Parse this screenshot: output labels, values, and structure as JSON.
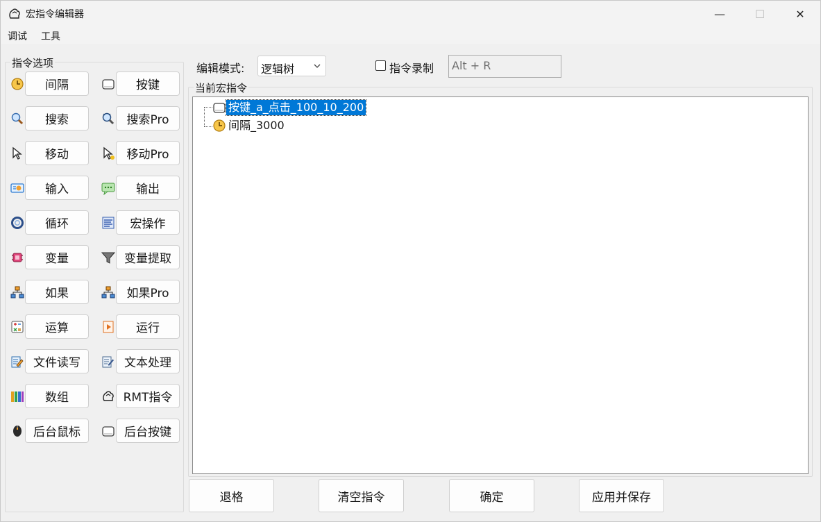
{
  "window": {
    "title": "宏指令编辑器",
    "minimize": "—",
    "maximize": "☐",
    "close": "✕"
  },
  "menu": [
    "调试",
    "工具"
  ],
  "palette": {
    "label": "指令选项",
    "left_column": [
      {
        "label": "间隔",
        "icon": "clock-icon"
      },
      {
        "label": "搜索",
        "icon": "magnifier-icon"
      },
      {
        "label": "移动",
        "icon": "cursor-icon"
      },
      {
        "label": "输入",
        "icon": "input-card-icon"
      },
      {
        "label": "循环",
        "icon": "loop-icon"
      },
      {
        "label": "变量",
        "icon": "chip-icon"
      },
      {
        "label": "如果",
        "icon": "hierarchy-icon"
      },
      {
        "label": "运算",
        "icon": "calculator-icon"
      },
      {
        "label": "文件读写",
        "icon": "file-edit-icon"
      },
      {
        "label": "数组",
        "icon": "array-bars-icon"
      },
      {
        "label": "后台鼠标",
        "icon": "mouse-icon"
      }
    ],
    "right_column": [
      {
        "label": "按键",
        "icon": "key-icon"
      },
      {
        "label": "搜索Pro",
        "icon": "magnifier-pro-icon"
      },
      {
        "label": "移动Pro",
        "icon": "cursor-pro-icon"
      },
      {
        "label": "输出",
        "icon": "chat-bubble-icon"
      },
      {
        "label": "宏操作",
        "icon": "list-lines-icon"
      },
      {
        "label": "变量提取",
        "icon": "funnel-icon"
      },
      {
        "label": "如果Pro",
        "icon": "hierarchy-pro-icon"
      },
      {
        "label": "运行",
        "icon": "play-doc-icon"
      },
      {
        "label": "文本处理",
        "icon": "text-doc-icon"
      },
      {
        "label": "RMT指令",
        "icon": "app-logo-icon"
      },
      {
        "label": "后台按键",
        "icon": "key-icon"
      }
    ]
  },
  "toolbar": {
    "mode_label": "编辑模式:",
    "mode_value": "逻辑树",
    "record_label": "指令录制",
    "record_checked": false,
    "hotkey": "Alt + R"
  },
  "tree": {
    "label": "当前宏指令",
    "nodes": [
      {
        "text": "按键_a_点击_100_10_200",
        "icon": "key-icon",
        "selected": true
      },
      {
        "text": "间隔_3000",
        "icon": "clock-icon",
        "selected": false
      }
    ]
  },
  "actions": [
    "退格",
    "清空指令",
    "确定",
    "应用并保存"
  ],
  "colors": {
    "selection": "#0078d7",
    "window_bg": "#f0f0f0",
    "button_bg": "#fdfdfd"
  }
}
